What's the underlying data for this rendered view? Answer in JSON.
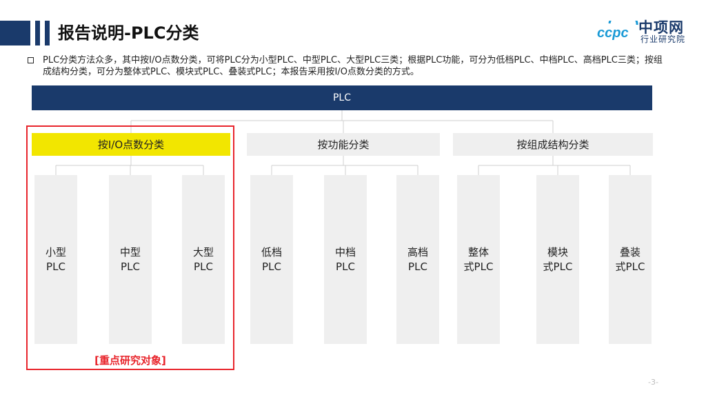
{
  "header": {
    "title": "报告说明-PLC分类",
    "logo_mark": "ccpc",
    "logo_name": "中项网",
    "logo_sub": "行业研究院"
  },
  "description": "PLC分类方法众多，其中按I/O点数分类，可将PLC分为小型PLC、中型PLC、大型PLC三类；根据PLC功能，可分为低档PLC、中档PLC、高档PLC三类；按组成结构分类，可分为整体式PLC、模块式PLC、叠装式PLC；本报告采用按I/O点数分类的方式。",
  "diagram": {
    "root": "PLC",
    "categories": [
      {
        "label": "按I/O点数分类",
        "highlight_color": "#f2e600",
        "children": [
          [
            "小型",
            "PLC"
          ],
          [
            "中型",
            "PLC"
          ],
          [
            "大型",
            "PLC"
          ]
        ]
      },
      {
        "label": "按功能分类",
        "children": [
          [
            "低档",
            "PLC"
          ],
          [
            "中档",
            "PLC"
          ],
          [
            "高档",
            "PLC"
          ]
        ]
      },
      {
        "label": "按组成结构分类",
        "children": [
          [
            "整体",
            "式PLC"
          ],
          [
            "模块",
            "式PLC"
          ],
          [
            "叠装",
            "式PLC"
          ]
        ]
      }
    ],
    "focus_label": "[重点研究对象]"
  },
  "colors": {
    "brand_navy": "#1a3a6b",
    "highlight": "#f2e600",
    "focus_red": "#e8242b",
    "box_gray": "#efefef"
  },
  "footer": {
    "page": "-3-"
  }
}
